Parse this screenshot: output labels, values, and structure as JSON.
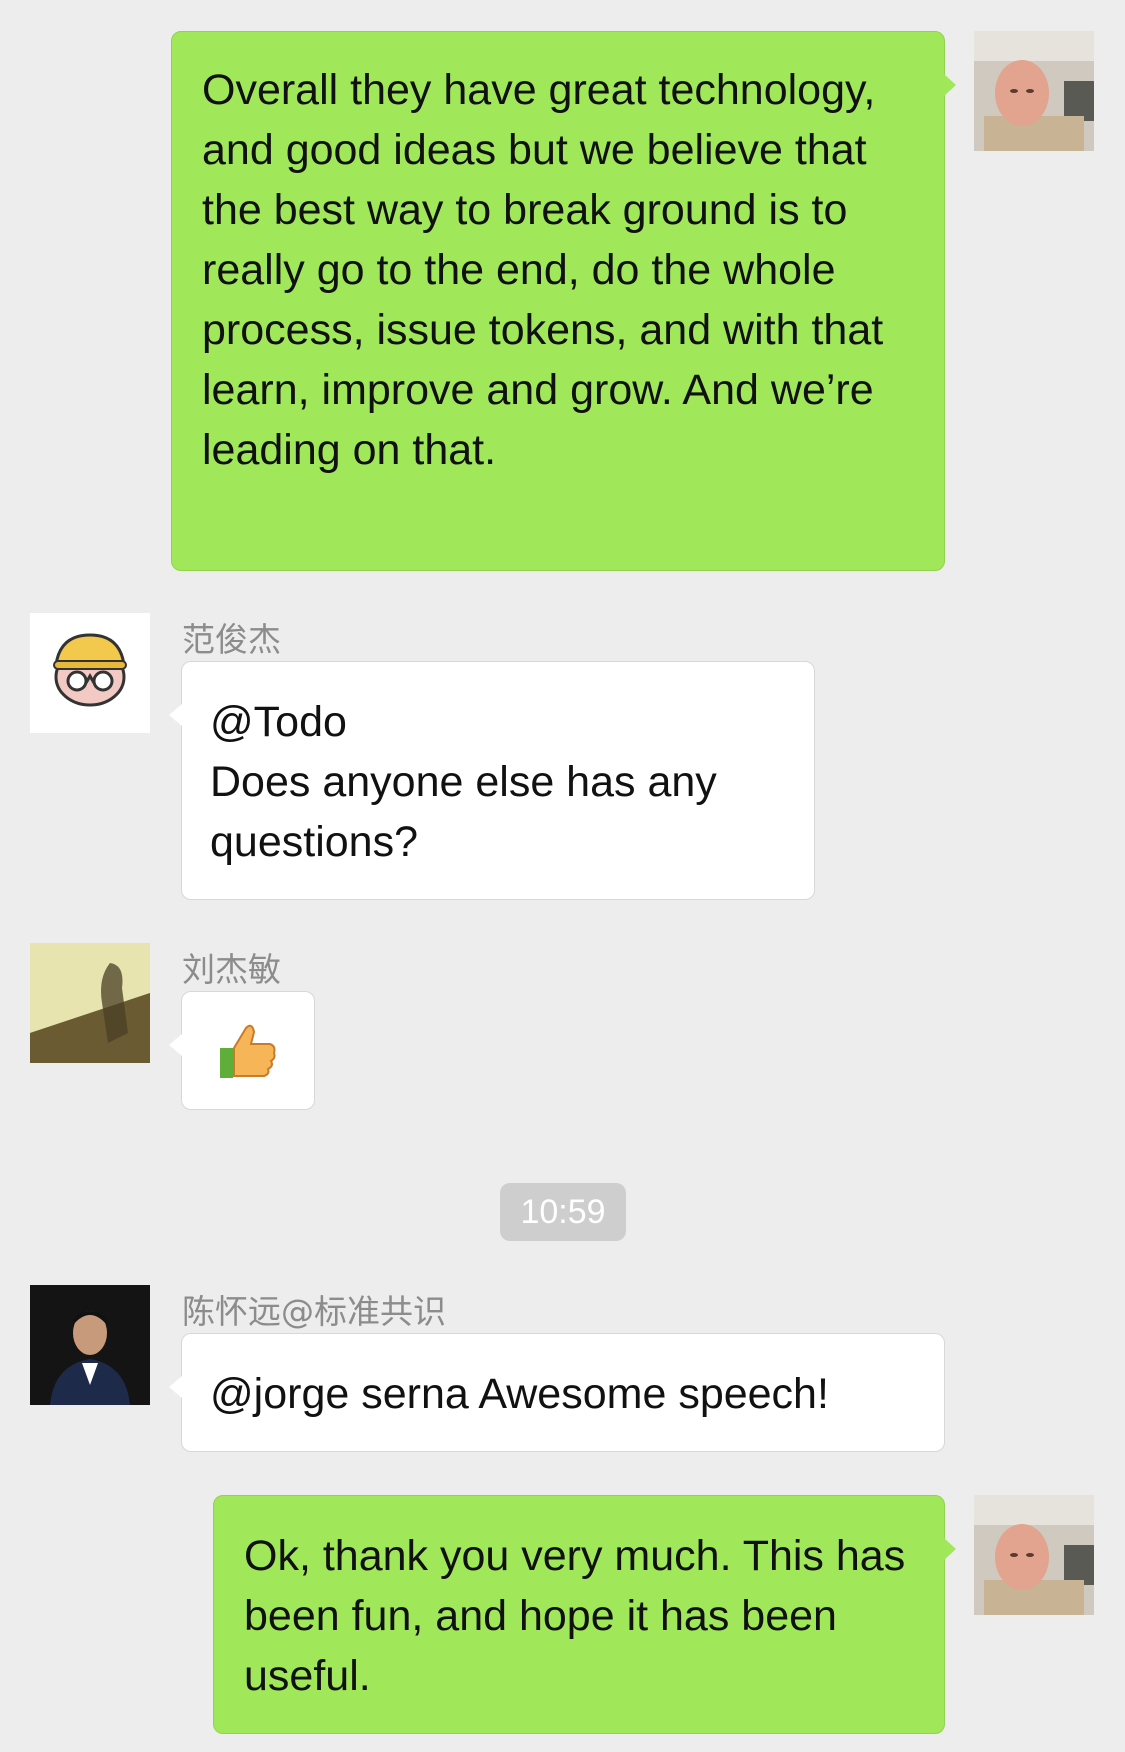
{
  "messages": [
    {
      "id": "m1",
      "direction": "outgoing",
      "avatar_icon": "selfie-avatar-icon",
      "text": "Overall they have great technology, and good ideas but we believe that the best way to break ground is to really go to the end, do the whole process, issue tokens, and with that learn, improve and grow. And we’re leading on that."
    },
    {
      "id": "m2",
      "direction": "incoming",
      "sender": "范俊杰",
      "avatar_icon": "cartoon-hat-avatar-icon",
      "lines": [
        "@Todo",
        "Does anyone else has any questions?"
      ]
    },
    {
      "id": "m3",
      "direction": "incoming",
      "sender": "刘杰敏",
      "avatar_icon": "shadow-photo-avatar-icon",
      "emoji_icon": "thumbs-up-icon"
    },
    {
      "id": "m4",
      "direction": "incoming",
      "sender": "陈怀远@标准共识",
      "avatar_icon": "suit-portrait-avatar-icon",
      "text": "@jorge serna Awesome speech!"
    },
    {
      "id": "m5",
      "direction": "outgoing",
      "avatar_icon": "selfie-avatar-icon",
      "text": "Ok, thank you very much. This has been fun, and hope it has been useful."
    }
  ],
  "timestamp": "10:59",
  "colors": {
    "background": "#ededed",
    "outgoing_bubble": "#a0e75a",
    "incoming_bubble": "#ffffff",
    "sender_name": "#8c8c8c",
    "timestamp_pill": "#cecece"
  }
}
